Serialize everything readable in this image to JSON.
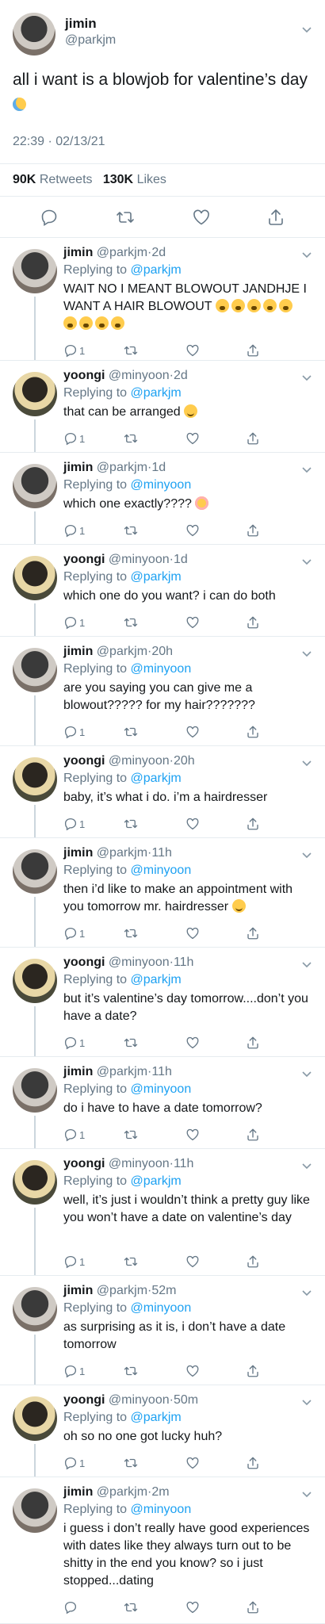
{
  "main": {
    "name": "jimin",
    "handle": "@parkjm",
    "text": "all i want is a blowjob for valentine’s day",
    "emoji": "crying-face",
    "time": "22:39 · 02/13/21",
    "retweets_count": "90K",
    "retweets_label": "Retweets",
    "likes_count": "130K",
    "likes_label": "Likes"
  },
  "replies": [
    {
      "name": "jimin",
      "handle": "@parkjm",
      "time": "2d",
      "reply_prefix": "Replying to",
      "reply_to": "@parkjm",
      "text": "WAIT NO I MEANT BLOWOUT JANDHJE I WANT A HAIR BLOWOUT",
      "count": "1"
    },
    {
      "name": "yoongi",
      "handle": "@minyoon",
      "time": "2d",
      "reply_prefix": "Replying to",
      "reply_to": "@parkjm",
      "text": "that can be arranged",
      "count": "1"
    },
    {
      "name": "jimin",
      "handle": "@parkjm",
      "time": "1d",
      "reply_prefix": "Replying to",
      "reply_to": "@minyoon",
      "text": "which one exactly????",
      "count": "1"
    },
    {
      "name": "yoongi",
      "handle": "@minyoon",
      "time": "1d",
      "reply_prefix": "Replying to",
      "reply_to": "@parkjm",
      "text": "which one do you want? i can do both",
      "count": "1"
    },
    {
      "name": "jimin",
      "handle": "@parkjm",
      "time": "20h",
      "reply_prefix": "Replying to",
      "reply_to": "@minyoon",
      "text": "are you saying you can give me a blowout????? for my hair???????",
      "count": "1"
    },
    {
      "name": "yoongi",
      "handle": "@minyoon",
      "time": "20h",
      "reply_prefix": "Replying to",
      "reply_to": "@parkjm",
      "text": "baby, it’s what i do. i’m a hairdresser",
      "count": "1"
    },
    {
      "name": "jimin",
      "handle": "@parkjm",
      "time": "11h",
      "reply_prefix": "Replying to",
      "reply_to": "@minyoon",
      "text": "then i’d like to make an appointment with you tomorrow mr. hairdresser",
      "count": "1"
    },
    {
      "name": "yoongi",
      "handle": "@minyoon",
      "time": "11h",
      "reply_prefix": "Replying to",
      "reply_to": "@parkjm",
      "text": "but it’s valentine’s day tomorrow....don’t you have a date?",
      "count": "1"
    },
    {
      "name": "jimin",
      "handle": "@parkjm",
      "time": "11h",
      "reply_prefix": "Replying to",
      "reply_to": "@minyoon",
      "text": "do i have to have a date tomorrow?",
      "count": "1"
    },
    {
      "name": "yoongi",
      "handle": "@minyoon",
      "time": "11h",
      "reply_prefix": "Replying to",
      "reply_to": "@parkjm",
      "text": "well, it’s just i wouldn’t think a pretty guy like you won’t have a date on valentine’s day",
      "count": "1"
    },
    {
      "name": "jimin",
      "handle": "@parkjm",
      "time": "52m",
      "reply_prefix": "Replying to",
      "reply_to": "@minyoon",
      "text": "as surprising as it is, i don’t have a date tomorrow",
      "count": "1"
    },
    {
      "name": "yoongi",
      "handle": "@minyoon",
      "time": "50m",
      "reply_prefix": "Replying to",
      "reply_to": "@parkjm",
      "text": "oh so no one got lucky huh?",
      "count": "1"
    },
    {
      "name": "jimin",
      "handle": "@parkjm",
      "time": "2m",
      "reply_prefix": "Replying to",
      "reply_to": "@minyoon",
      "text": "i guess i don’t really have good experiences with dates like they always turn out to be shitty in the end you know? so i just stopped...dating",
      "count": ""
    }
  ],
  "colors": {
    "link": "#1da1f2",
    "muted": "#657786",
    "text": "#14171a",
    "border": "#e6ecf0"
  },
  "icons": [
    "chevron-down-icon",
    "reply-icon",
    "retweet-icon",
    "like-icon",
    "share-icon"
  ]
}
